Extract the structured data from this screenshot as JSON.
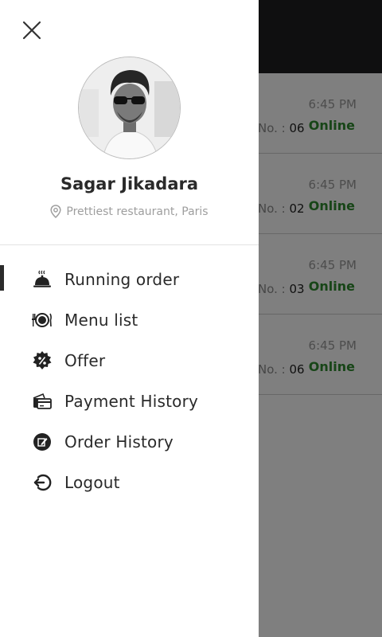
{
  "background": {
    "orders": [
      {
        "time": "6:45 PM",
        "table_prefix": "No. : ",
        "table_no": "06",
        "status": "Online"
      },
      {
        "time": "6:45 PM",
        "table_prefix": "No. : ",
        "table_no": "02",
        "status": "Online"
      },
      {
        "time": "6:45 PM",
        "table_prefix": "No. : ",
        "table_no": "03",
        "status": "Online"
      },
      {
        "time": "6:45 PM",
        "table_prefix": "No. : ",
        "table_no": "06",
        "status": "Online"
      }
    ]
  },
  "drawer": {
    "profile": {
      "name": "Sagar Jikadara",
      "location": "Prettiest restaurant, Paris"
    },
    "menu": [
      {
        "label": "Running order",
        "icon": "cloche-icon",
        "active": true
      },
      {
        "label": "Menu list",
        "icon": "plate-cutlery-icon",
        "active": false
      },
      {
        "label": "Offer",
        "icon": "discount-badge-icon",
        "active": false
      },
      {
        "label": "Payment History",
        "icon": "wallet-card-icon",
        "active": false
      },
      {
        "label": "Order History",
        "icon": "order-edit-icon",
        "active": false
      },
      {
        "label": "Logout",
        "icon": "logout-icon",
        "active": false
      }
    ]
  },
  "colors": {
    "status_online": "#2e8b2e",
    "topbar": "#1f1f21",
    "scrim": "rgba(0,0,0,0.5)"
  }
}
